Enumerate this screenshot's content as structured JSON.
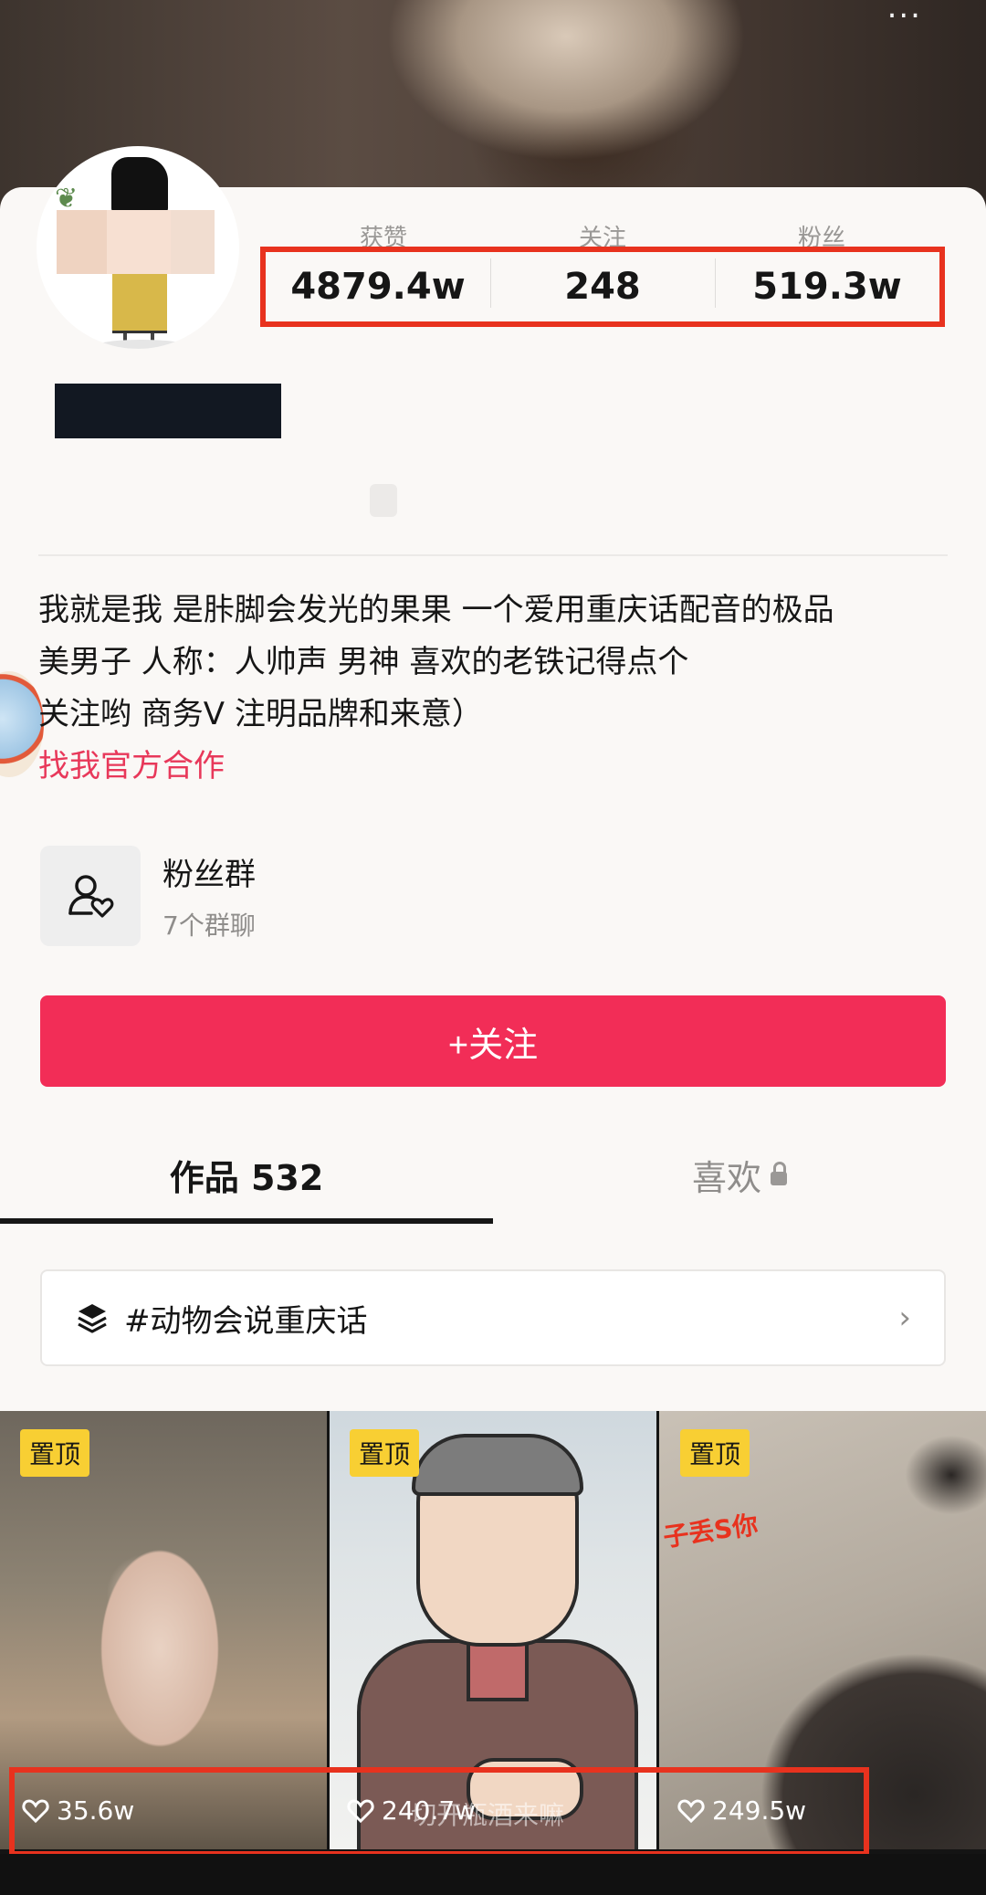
{
  "cover": {
    "status_glyph": "..."
  },
  "stats": {
    "labels": [
      "获赞",
      "关注",
      "粉丝"
    ],
    "values": [
      "4879.4w",
      "248",
      "519.3w"
    ]
  },
  "bio": {
    "line1": "我就是我  是胩脚会发光的果果 一个爱用重庆话配音的极品",
    "line2": "美男子 人称：人帅声           男神   喜欢的老铁记得点个",
    "line3": "关注哟        商务V                          注明品牌和来意）",
    "link": "找我官方合作"
  },
  "fan_group": {
    "title": "粉丝群",
    "subtitle": "7个群聊",
    "icon": "user-heart-icon"
  },
  "follow_button": "+关注",
  "tabs": {
    "works": "作品 532",
    "likes": "喜欢"
  },
  "collection": {
    "label": "#动物会说重庆话",
    "icon": "layers-icon"
  },
  "videos": [
    {
      "pin": "置顶",
      "likes": "35.6w"
    },
    {
      "pin": "置顶",
      "likes": "240.7w",
      "caption": "切开瓶酒来嘛"
    },
    {
      "pin": "置顶",
      "likes": "249.5w",
      "overlay_text": "子丢S你"
    }
  ],
  "colors": {
    "accent": "#f22d57",
    "link": "#e8385a",
    "highlight": "#e8321e",
    "pin": "#f8cf33"
  }
}
